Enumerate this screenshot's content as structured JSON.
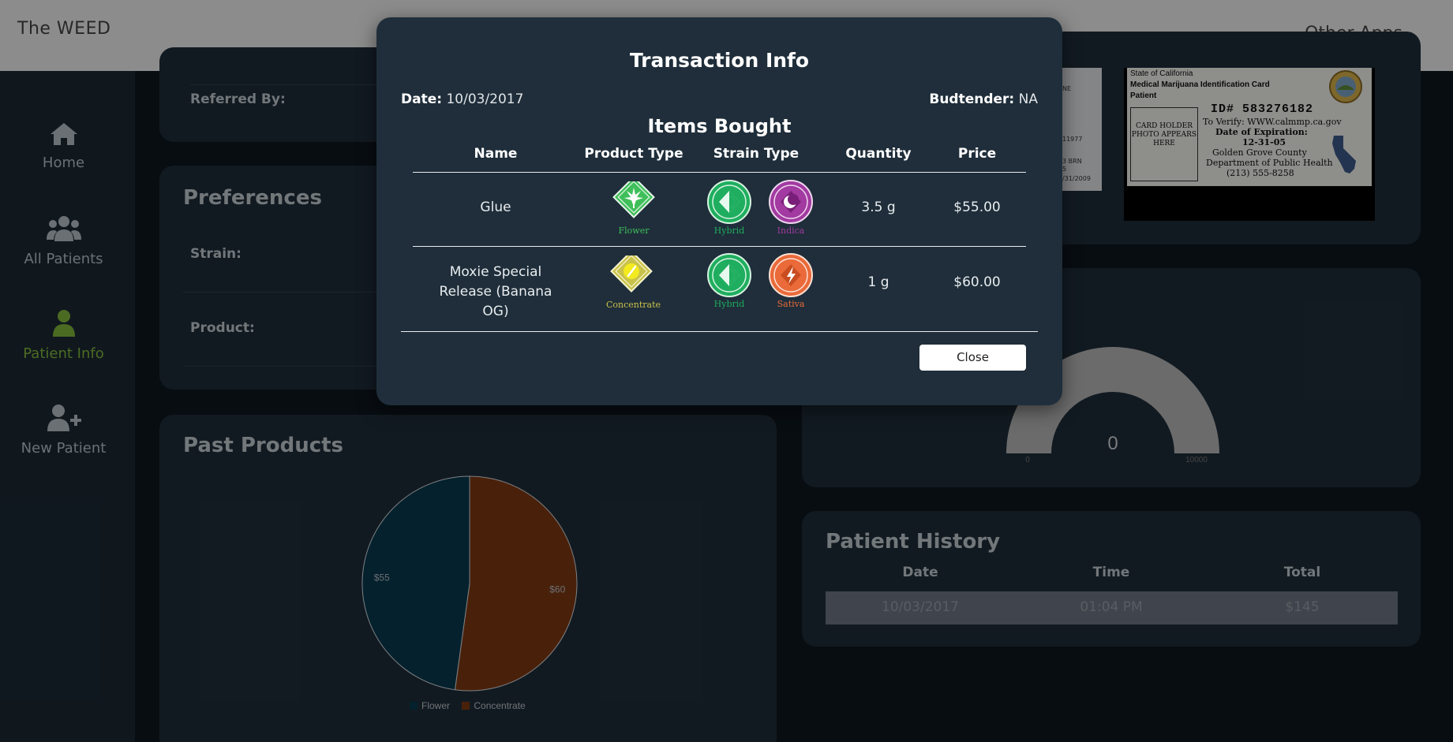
{
  "navbar": {
    "brand": "The WEED",
    "apps_label": "Other Apps"
  },
  "sidebar": {
    "items": [
      {
        "label": "Home",
        "icon": "home-icon",
        "active": false
      },
      {
        "label": "All Patients",
        "icon": "users-icon",
        "active": false
      },
      {
        "label": "Patient Info",
        "icon": "user-icon",
        "active": true
      },
      {
        "label": "New Patient",
        "icon": "user-plus-icon",
        "active": false
      }
    ]
  },
  "info_card": {
    "referred_label": "Referred By:"
  },
  "preferences": {
    "title": "Preferences",
    "strain_label": "Strain:",
    "product_label": "Product:"
  },
  "id_card": {
    "state": "State of California",
    "title": "Medical Marijuana Identification Card",
    "subtitle": "Patient",
    "photo_text": "CARD HOLDER PHOTO APPEARS HERE",
    "id_number": "ID# 583276182",
    "verify": "To Verify: WWW.calmmp.ca.gov",
    "exp_label": "Date of Expiration:",
    "exp_date": "12-31-05",
    "county": "Golden Grove County",
    "dept": "Department of Public Health",
    "phone": "(213) 555-8258",
    "partial_lines": [
      "NE",
      "11977",
      "3 BRN",
      "5",
      "/31/2009"
    ]
  },
  "gauge": {
    "value": "0",
    "min": "0",
    "max": "10000",
    "level": 0
  },
  "past_products": {
    "title": "Past Products",
    "chart_data": {
      "type": "pie",
      "categories": [
        "Flower",
        "Concentrate"
      ],
      "values": [
        55,
        60
      ],
      "data_labels": [
        "$55",
        "$60"
      ],
      "colors": [
        "#08394f",
        "#7f3a14"
      ],
      "legend_position": "bottom"
    }
  },
  "patient_history": {
    "title": "Patient History",
    "columns": [
      "Date",
      "Time",
      "Total"
    ],
    "rows": [
      {
        "date": "10/03/2017",
        "time": "01:04 PM",
        "total": "$145"
      }
    ]
  },
  "modal": {
    "title": "Transaction Info",
    "date_label": "Date:",
    "date_value": "10/03/2017",
    "budtender_label": "Budtender:",
    "budtender_value": "NA",
    "items_title": "Items Bought",
    "columns": [
      "Name",
      "Product Type",
      "Strain Type",
      "Quantity",
      "Price"
    ],
    "items": [
      {
        "name": "Glue",
        "product_type": "Flower",
        "product_color": "#3fbf5a",
        "strains": [
          {
            "label": "Hybrid",
            "color": "#1fae5f"
          },
          {
            "label": "Indica",
            "color": "#a23aa1"
          }
        ],
        "quantity": "3.5 g",
        "price": "$55.00"
      },
      {
        "name": "Moxie Special Release (Banana OG)",
        "product_type": "Concentrate",
        "product_color": "#c9c24a",
        "strains": [
          {
            "label": "Hybrid",
            "color": "#1fae5f"
          },
          {
            "label": "Sativa",
            "color": "#ea6a3a"
          }
        ],
        "quantity": "1 g",
        "price": "$60.00"
      }
    ],
    "close_label": "Close"
  }
}
